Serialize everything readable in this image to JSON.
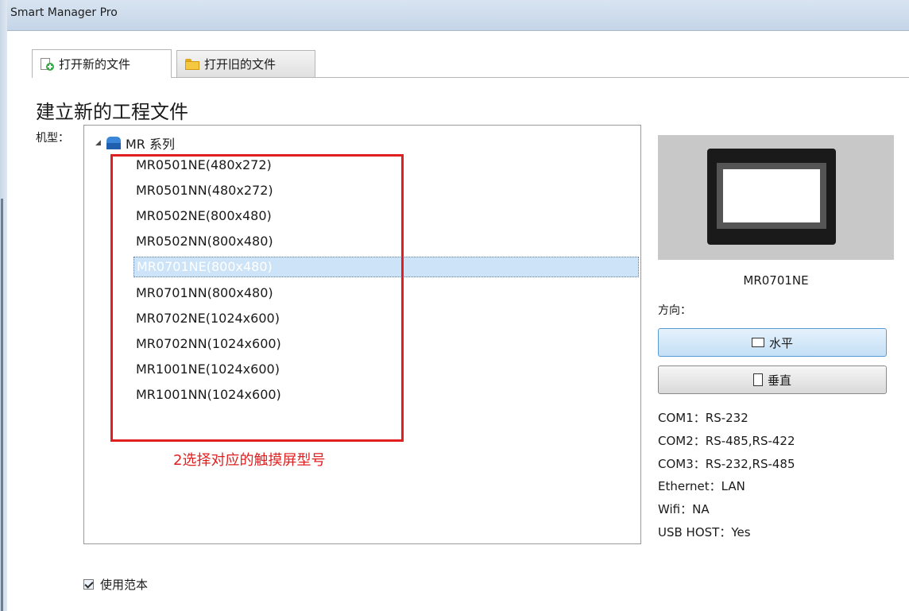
{
  "window": {
    "title": "Smart Manager Pro"
  },
  "tabs": [
    {
      "label": "打开新的文件",
      "icon": "new-document-icon",
      "active": true
    },
    {
      "label": "打开旧的文件",
      "icon": "folder-icon",
      "active": false
    }
  ],
  "main": {
    "heading": "建立新的工程文件",
    "model_label": "机型："
  },
  "tree": {
    "root": {
      "label": "MR 系列",
      "icon": "device-series-icon",
      "expanded": true
    },
    "items": [
      {
        "label": "MR0501NE(480x272)"
      },
      {
        "label": "MR0501NN(480x272)"
      },
      {
        "label": "MR0502NE(800x480)"
      },
      {
        "label": "MR0502NN(800x480)"
      },
      {
        "label": "MR0701NE(800x480)",
        "selected": true
      },
      {
        "label": "MR0701NN(800x480)"
      },
      {
        "label": "MR0702NE(1024x600)"
      },
      {
        "label": "MR0702NN(1024x600)"
      },
      {
        "label": "MR1001NE(1024x600)"
      },
      {
        "label": "MR1001NN(1024x600)"
      }
    ]
  },
  "annotation": {
    "text": "2选择对应的触摸屏型号",
    "color": "#e02020"
  },
  "preview": {
    "model_name": "MR0701NE"
  },
  "orientation": {
    "label": "方向：",
    "horizontal": "水平",
    "vertical": "垂直"
  },
  "specs": [
    "COM1：RS-232",
    "COM2：RS-485,RS-422",
    "COM3：RS-232,RS-485",
    "Ethernet：LAN",
    "Wifi：NA",
    "USB HOST：Yes"
  ],
  "template_option": {
    "label": "使用范本",
    "checked": true
  },
  "colors": {
    "selection": "#cde3f7",
    "highlight_box": "#e02020",
    "accent": "#5a9bd5"
  }
}
